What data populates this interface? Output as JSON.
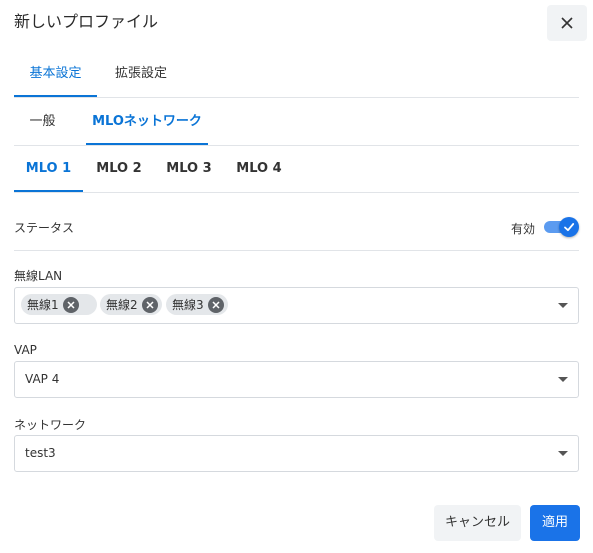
{
  "dialog": {
    "title": "新しいプロファイル",
    "close_icon": "close-icon"
  },
  "main_tabs": [
    {
      "label": "基本設定",
      "active": true
    },
    {
      "label": "拡張設定",
      "active": false
    }
  ],
  "sub_tabs": [
    {
      "label": "一般",
      "active": false
    },
    {
      "label": "MLOネットワーク",
      "active": true
    }
  ],
  "mlo_tabs": [
    {
      "label": "MLO 1",
      "active": true
    },
    {
      "label": "MLO 2",
      "active": false
    },
    {
      "label": "MLO 3",
      "active": false
    },
    {
      "label": "MLO 4",
      "active": false
    }
  ],
  "status": {
    "label": "ステータス",
    "toggle_label": "有効",
    "enabled": true
  },
  "wireless_lan": {
    "label": "無線LAN",
    "chips": [
      "無線1",
      "無線2",
      "無線3"
    ]
  },
  "vap": {
    "label": "VAP",
    "value": "VAP 4"
  },
  "network": {
    "label": "ネットワーク",
    "value": "test3"
  },
  "buttons": {
    "cancel": "キャンセル",
    "apply": "適用"
  },
  "colors": {
    "accent": "#1a73e8",
    "tab_active": "#0a74d6"
  }
}
